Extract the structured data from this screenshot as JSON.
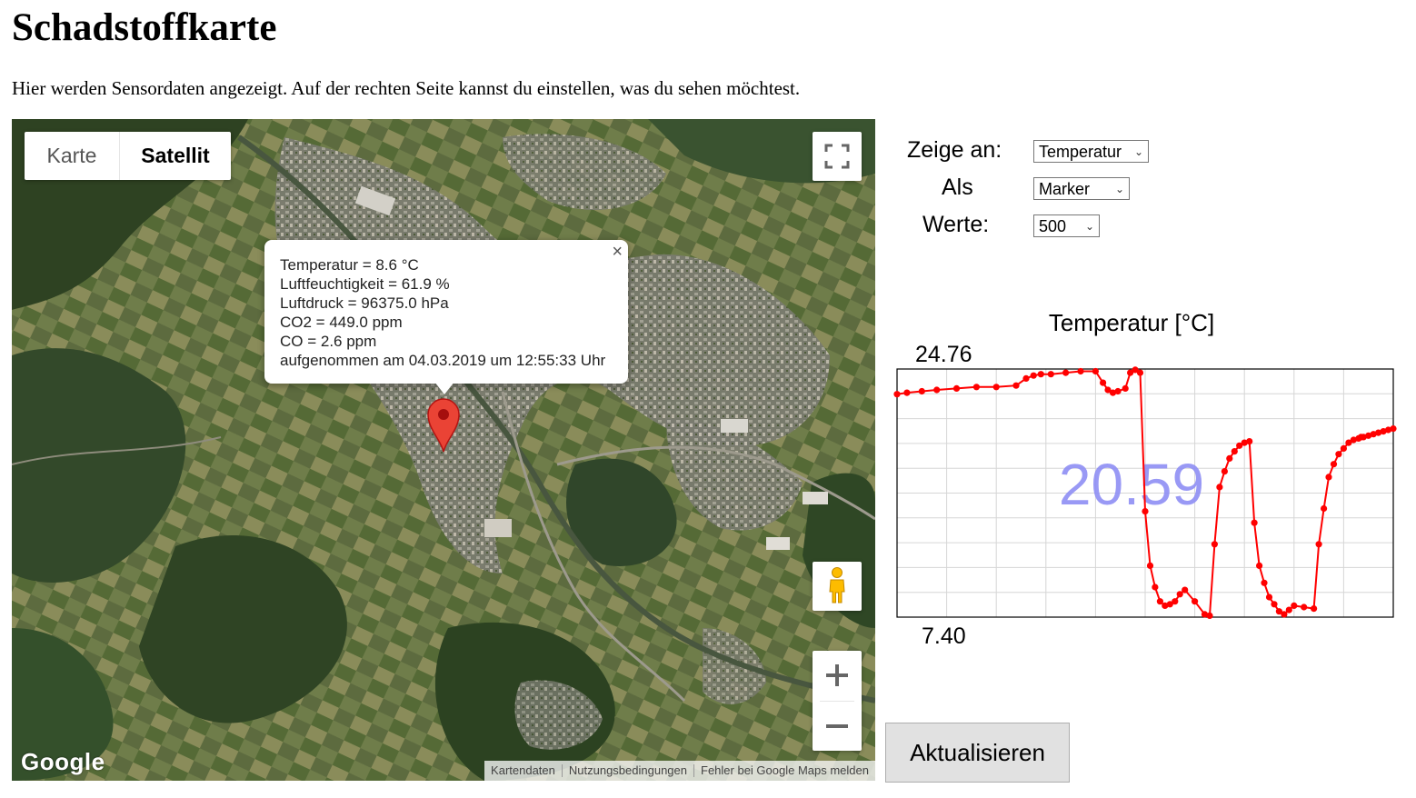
{
  "page": {
    "title": "Schadstoffkarte",
    "intro": "Hier werden Sensordaten angezeigt. Auf der rechten Seite kannst du einstellen, was du sehen möchtest."
  },
  "map": {
    "type_control": {
      "map_label": "Karte",
      "satellite_label": "Satellit",
      "selected": "Satellit"
    },
    "logo": "Google",
    "attribution": {
      "data": "Kartendaten",
      "terms": "Nutzungsbedingungen",
      "report": "Fehler bei Google Maps melden"
    },
    "infowindow": {
      "lines": [
        "Temperatur = 8.6 °C",
        "Luftfeuchtigkeit = 61.9 %",
        "Luftdruck = 96375.0 hPa",
        "CO2 = 449.0 ppm",
        "CO = 2.6 ppm",
        "aufgenommen am 04.03.2019 um 12:55:33 Uhr"
      ],
      "close_glyph": "×"
    },
    "icons": {
      "fullscreen": "fullscreen-icon",
      "pegman": "pegman-icon",
      "zoom_in": "plus-icon",
      "zoom_out": "minus-icon",
      "marker": "map-marker-icon"
    },
    "marker_color": "#ea4335"
  },
  "controls": {
    "show_label": "Zeige an:",
    "show_value": "Temperatur",
    "as_label": "Als",
    "as_value": "Marker",
    "values_label": "Werte:",
    "values_value": "500",
    "refresh_label": "Aktualisieren"
  },
  "chart_data": {
    "type": "line",
    "title": "Temperatur [°C]",
    "ylim": [
      7.4,
      24.76
    ],
    "ymax_label": "24.76",
    "ymin_label": "7.40",
    "overlay_value": "20.59",
    "grid": true,
    "series_color": "#ff0000",
    "overlay_color": "#8f8ff5",
    "x_range": [
      0,
      100
    ],
    "series": [
      {
        "x": [
          0,
          2,
          5,
          8,
          12,
          16,
          20,
          24,
          26,
          27.5,
          29,
          31,
          34,
          37,
          40,
          41.5,
          42.5,
          43.5,
          44.5,
          46,
          47,
          48,
          49,
          50,
          51,
          52,
          53,
          54,
          55,
          56,
          57,
          58,
          60,
          62,
          63,
          64,
          65,
          66,
          67,
          68,
          69,
          70,
          71,
          72,
          73,
          74,
          75,
          76,
          77,
          78,
          79,
          80,
          82,
          84,
          85,
          86,
          87,
          88,
          89,
          90,
          91,
          92,
          93,
          93.5,
          94,
          95,
          96,
          97,
          98,
          99,
          100
        ],
        "y": [
          23.0,
          23.1,
          23.2,
          23.3,
          23.4,
          23.5,
          23.5,
          23.6,
          24.1,
          24.3,
          24.4,
          24.4,
          24.5,
          24.6,
          24.6,
          23.8,
          23.3,
          23.1,
          23.2,
          23.4,
          24.5,
          24.7,
          24.5,
          14.8,
          11.0,
          9.5,
          8.5,
          8.2,
          8.3,
          8.5,
          9.0,
          9.3,
          8.5,
          7.6,
          7.5,
          12.5,
          16.5,
          17.6,
          18.5,
          19.0,
          19.4,
          19.6,
          19.7,
          14.0,
          11.0,
          9.8,
          8.8,
          8.3,
          7.8,
          7.6,
          7.9,
          8.2,
          8.1,
          8.0,
          12.5,
          15.0,
          17.2,
          18.1,
          18.8,
          19.2,
          19.6,
          19.8,
          19.9,
          20.0,
          20.0,
          20.1,
          20.2,
          20.3,
          20.4,
          20.5,
          20.59
        ]
      }
    ]
  }
}
